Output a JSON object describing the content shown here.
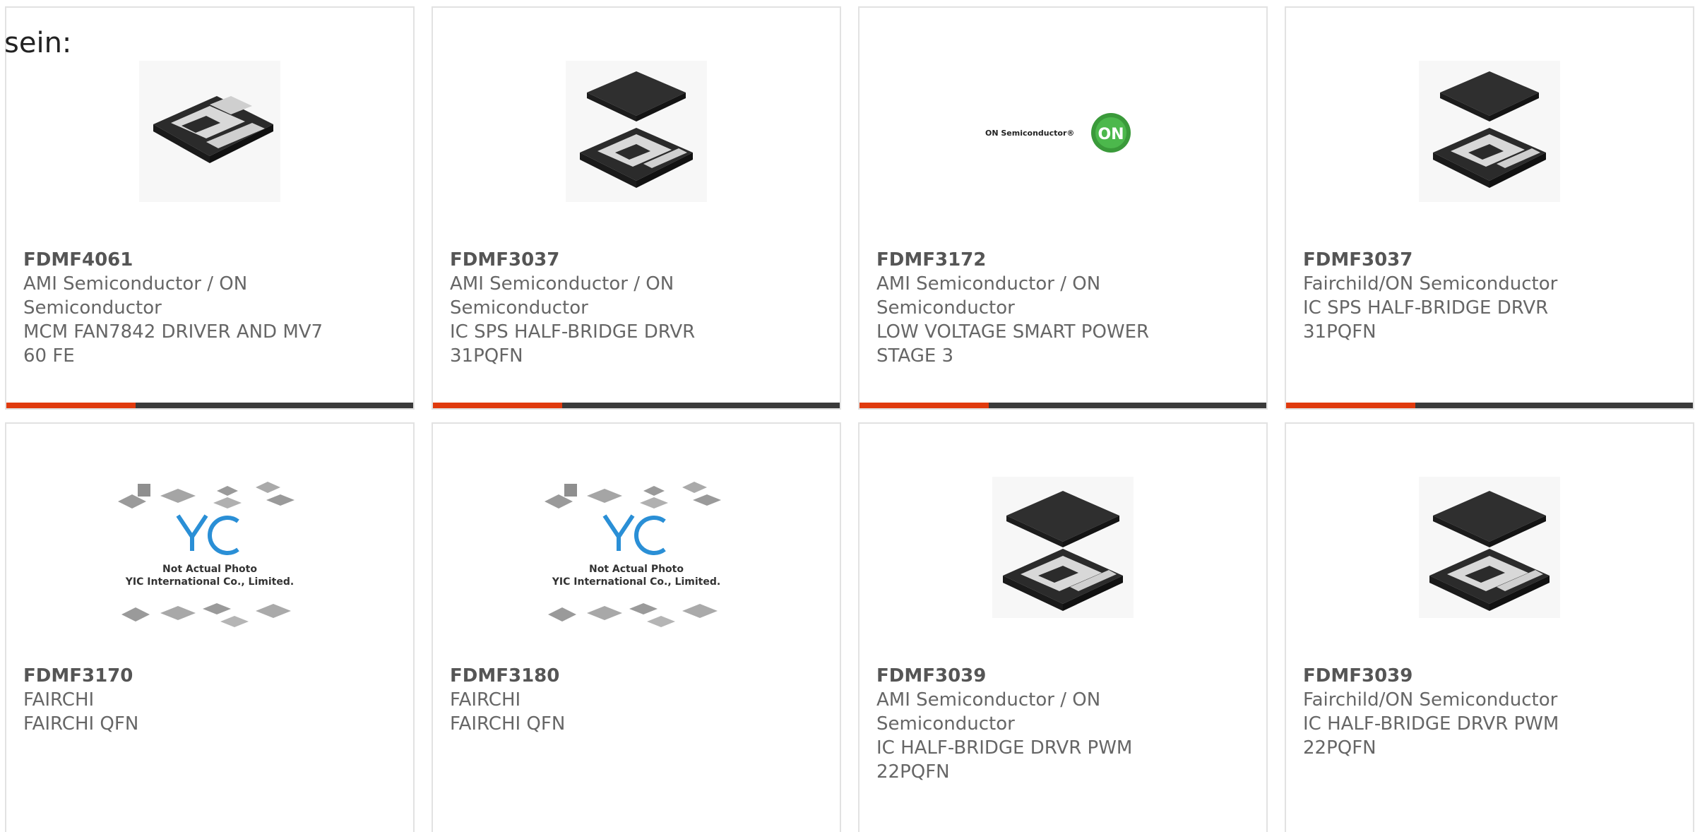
{
  "intro_text": "sein:",
  "colors": {
    "accent": "#e03a0e",
    "bar": "#3a3a3a",
    "yic_blue": "#2a8fd6"
  },
  "products": [
    {
      "part": "FDMF4061",
      "manufacturer": "AMI Semiconductor / ON Semiconductor",
      "description": "MCM FAN7842 DRIVER AND MV7 60 FE",
      "image": "qfn-chip-bottom-view"
    },
    {
      "part": "FDMF3037",
      "manufacturer": "AMI Semiconductor / ON Semiconductor",
      "description": "IC SPS HALF-BRIDGE DRVR 31PQFN",
      "image": "qfn-chip-top-bottom-view"
    },
    {
      "part": "FDMF3172",
      "manufacturer": "AMI Semiconductor / ON Semiconductor",
      "description": "LOW VOLTAGE SMART POWER STAGE 3",
      "image": "on-semiconductor-logo",
      "logo_text": "ON Semiconductor®",
      "logo_badge": "ON"
    },
    {
      "part": "FDMF3037",
      "manufacturer": "Fairchild/ON Semiconductor",
      "description": "IC SPS HALF-BRIDGE DRVR 31PQFN",
      "image": "qfn-chip-top-bottom-view"
    },
    {
      "part": "FDMF3170",
      "manufacturer": "FAIRCHI",
      "description": "FAIRCHI QFN",
      "image": "yic-placeholder",
      "placeholder_line1": "Not Actual Photo",
      "placeholder_line2": "YIC International Co., Limited."
    },
    {
      "part": "FDMF3180",
      "manufacturer": "FAIRCHI",
      "description": "FAIRCHI QFN",
      "image": "yic-placeholder",
      "placeholder_line1": "Not Actual Photo",
      "placeholder_line2": "YIC International Co., Limited."
    },
    {
      "part": "FDMF3039",
      "manufacturer": "AMI Semiconductor / ON Semiconductor",
      "description": "IC HALF-BRIDGE DRVR PWM 22PQFN",
      "image": "qfn-chip-top-bottom-view"
    },
    {
      "part": "FDMF3039",
      "manufacturer": "Fairchild/ON Semiconductor",
      "description": "IC HALF-BRIDGE DRVR PWM 22PQFN",
      "image": "qfn-chip-top-bottom-view"
    }
  ]
}
